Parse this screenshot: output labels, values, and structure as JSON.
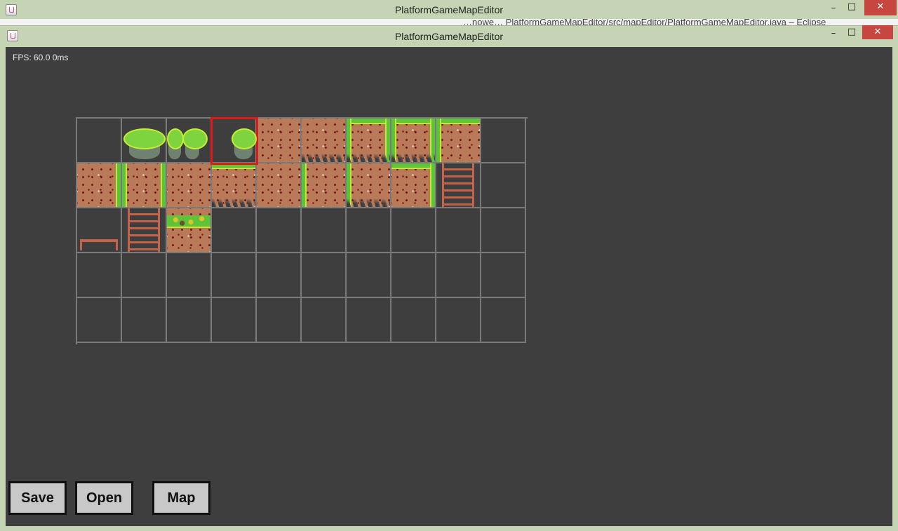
{
  "back_window": {
    "title": "PlatformGameMapEditor",
    "ghost_text": "…nowe… PlatformGameMapEditor/src/mapEditor/PlatformGameMapEditor.java – Eclipse",
    "controls": {
      "minimize": "–",
      "maximize": "□",
      "close": "✕"
    }
  },
  "front_window": {
    "title": "PlatformGameMapEditor",
    "controls": {
      "minimize": "–",
      "maximize": "□",
      "close": "✕"
    }
  },
  "editor": {
    "fps_text": "FPS: 60.0 0ms",
    "palette": {
      "rows": 5,
      "cols": 10,
      "selected_index": 3,
      "tiles": [
        "empty",
        "floating-island-wide",
        "floating-island-pair",
        "floating-island-right",
        "dirt",
        "dirt-spikes",
        "dirt-grass-top-left-right-spikes",
        "dirt-grass-top-left-right-spikes",
        "dirt-grass-top-left",
        "empty",
        "dirt-grass-right",
        "dirt-grass-left-right",
        "dirt",
        "dirt-grass-top-spikes",
        "dirt",
        "dirt-grass-left",
        "dirt-grass-left-spikes",
        "dirt-grass-top-right",
        "ladder",
        "empty",
        "platform",
        "ladder",
        "dirt-bush",
        "empty",
        "empty",
        "empty",
        "empty",
        "empty",
        "empty",
        "empty",
        "empty",
        "empty",
        "empty",
        "empty",
        "empty",
        "empty",
        "empty",
        "empty",
        "empty",
        "empty",
        "empty",
        "empty",
        "empty",
        "empty",
        "empty",
        "empty",
        "empty",
        "empty",
        "empty",
        "empty"
      ]
    },
    "buttons": {
      "save": "Save",
      "open": "Open",
      "map": "Map"
    }
  }
}
